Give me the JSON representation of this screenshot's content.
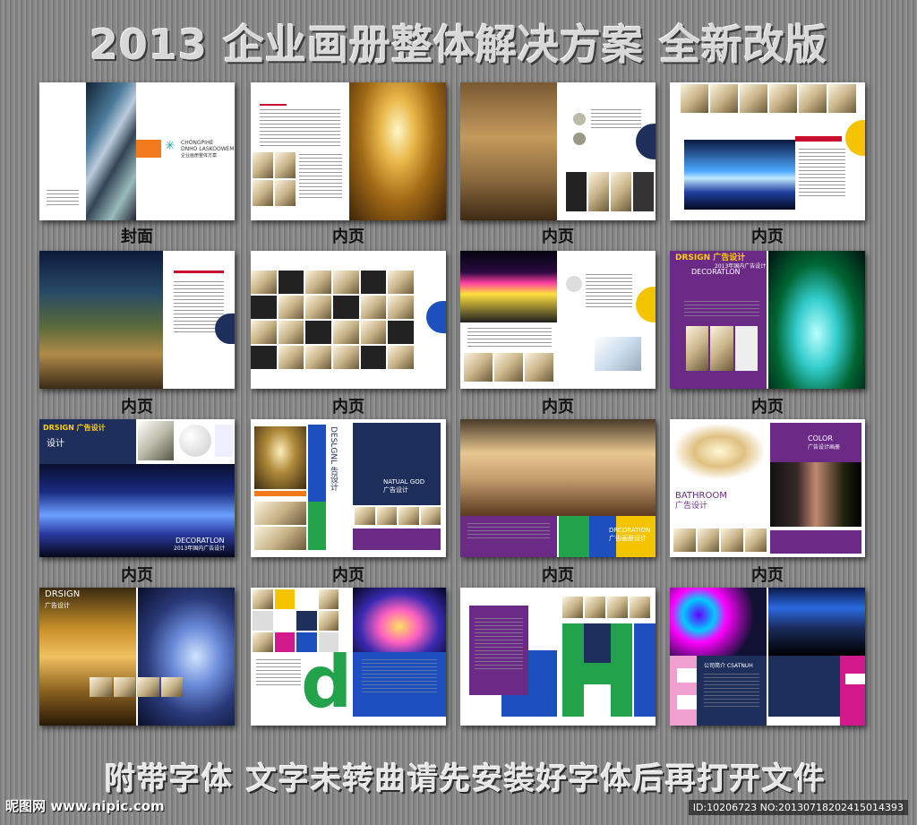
{
  "title": "2013 企业画册整体解决方案  全新改版",
  "footer": "附带字体 文字未转曲请先安装好字体后再打开文件",
  "watermark_left": "昵图网 www.nipic.com",
  "watermark_right": "ID:10206723 NO:20130718202415014393",
  "labels": {
    "cover": "封面",
    "inner": "内页"
  },
  "spreads": {
    "cover_brand_line1": "CHONGPIHE",
    "cover_brand_line2": "DNHO LASKOOWEM",
    "cover_brand_line3": "企业画册整体方案",
    "s8_title1": "DRSIGN 广告设计",
    "s8_title2": "2013年国内广告设计",
    "s8_title3": "DECORATLON",
    "s9_title1": "DRSIGN 广告设计",
    "s9_title2": "设计",
    "s9_title3": "DECORATLON",
    "s9_title4": "2013年国内广告设计",
    "s10_vert": "DESLGNL 告设计",
    "s10_title1": "NATUAL GOD",
    "s10_title2": "广告设计",
    "s11_title1": "DRCORATION",
    "s11_title2": "广告画册设计",
    "s12_title1": "COLOR",
    "s12_title2": "广告设计画册",
    "s12_title3": "BATHROOM",
    "s12_title4": "广告设计",
    "s13_title1": "DRSIGN",
    "s13_title2": "广告设计",
    "s14_letter": "d",
    "s16_title": "公司简介 CSATNUH"
  },
  "colors": {
    "orange": "#f07a1c",
    "navy": "#1f2f5c",
    "purple": "#6a2a86",
    "yellow": "#f5c400",
    "green": "#22a24a",
    "blue": "#1d4fbf",
    "magenta": "#d0198a",
    "red": "#c8102e"
  }
}
